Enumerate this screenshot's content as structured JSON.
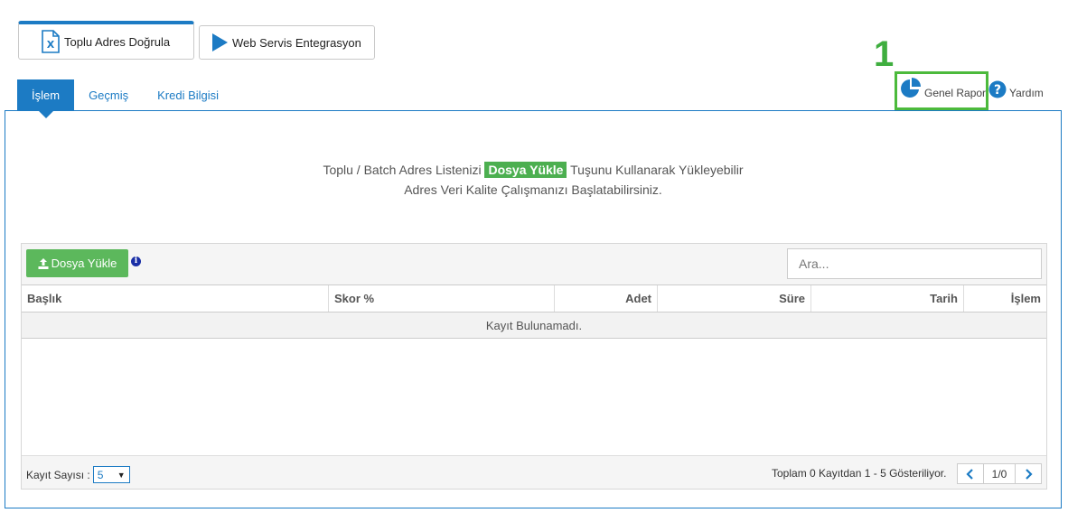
{
  "top_buttons": {
    "toplu_label": "Toplu Adres Doğrula",
    "web_label": "Web Servis Entegrasyon"
  },
  "tabs": [
    {
      "label": "İşlem",
      "active": true
    },
    {
      "label": "Geçmiş",
      "active": false
    },
    {
      "label": "Kredi Bilgisi",
      "active": false
    }
  ],
  "annotation_number": "1",
  "header_links": {
    "genel_rapor": "Genel Rapor",
    "yardim": "Yardım"
  },
  "info": {
    "line1_before": "Toplu / Batch Adres Listenizi ",
    "highlight": "Dosya Yükle",
    "line1_after": " Tuşunu Kullanarak Yükleyebilir",
    "line2": "Adres Veri Kalite Çalışmanızı Başlatabilirsiniz."
  },
  "panel": {
    "upload_label": "Dosya Yükle",
    "info_icon_glyph": "i",
    "search_placeholder": "Ara..."
  },
  "table": {
    "columns": [
      "Başlık",
      "Skor %",
      "Adet",
      "Süre",
      "Tarih",
      "İşlem"
    ],
    "empty_message": "Kayıt Bulunamadı."
  },
  "footer": {
    "kayit_label": "Kayıt Sayısı :",
    "page_size": "5",
    "summary": "Toplam 0 Kayıtdan 1 - 5 Gösteriliyor.",
    "page_indicator": "1/0"
  },
  "colors": {
    "primary": "#1c7bc4",
    "success": "#5cb85c",
    "annotation": "#4cba3c"
  }
}
